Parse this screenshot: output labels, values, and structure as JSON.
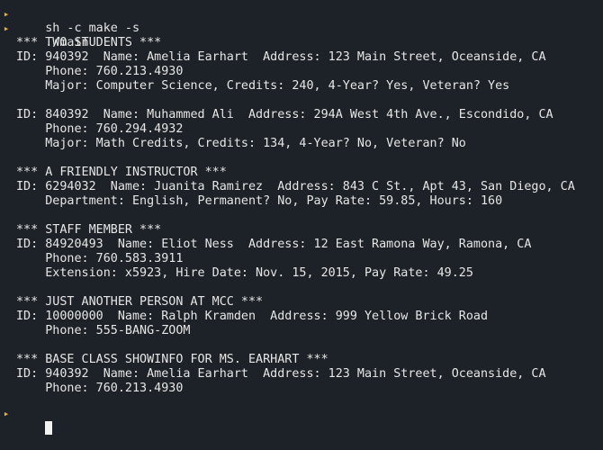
{
  "terminal": {
    "colors": {
      "background": "#1c2227",
      "text": "#e6e6e6",
      "prompt": "#e8b13a",
      "cursor": "#f2f2f2"
    },
    "commands": [
      "sh -c make -s",
      "./main"
    ],
    "output": {
      "l01": "*** TWO STUDENTS ***",
      "l02": "ID: 940392  Name: Amelia Earhart  Address: 123 Main Street, Oceanside, CA",
      "l03": "    Phone: 760.213.4930",
      "l04": "    Major: Computer Science, Credits: 240, 4-Year? Yes, Veteran? Yes",
      "l05": "ID: 840392  Name: Muhammed Ali  Address: 294A West 4th Ave., Escondido, CA",
      "l06": "    Phone: 760.294.4932",
      "l07": "    Major: Math Credits, Credits: 134, 4-Year? No, Veteran? No",
      "l08": "*** A FRIENDLY INSTRUCTOR ***",
      "l09": "ID: 6294032  Name: Juanita Ramirez  Address: 843 C St., Apt 43, San Diego, CA",
      "l10": "    Department: English, Permanent? No, Pay Rate: 59.85, Hours: 160",
      "l11": "*** STAFF MEMBER ***",
      "l12": "ID: 84920493  Name: Eliot Ness  Address: 12 East Ramona Way, Ramona, CA",
      "l13": "    Phone: 760.583.3911",
      "l14": "    Extension: x5923, Hire Date: Nov. 15, 2015, Pay Rate: 49.25",
      "l15": "*** JUST ANOTHER PERSON AT MCC ***",
      "l16": "ID: 10000000  Name: Ralph Kramden  Address: 999 Yellow Brick Road",
      "l17": "    Phone: 555-BANG-ZOOM",
      "l18": "*** BASE CLASS SHOWINFO FOR MS. EARHART ***",
      "l19": "ID: 940392  Name: Amelia Earhart  Address: 123 Main Street, Oceanside, CA",
      "l20": "    Phone: 760.213.4930"
    }
  }
}
